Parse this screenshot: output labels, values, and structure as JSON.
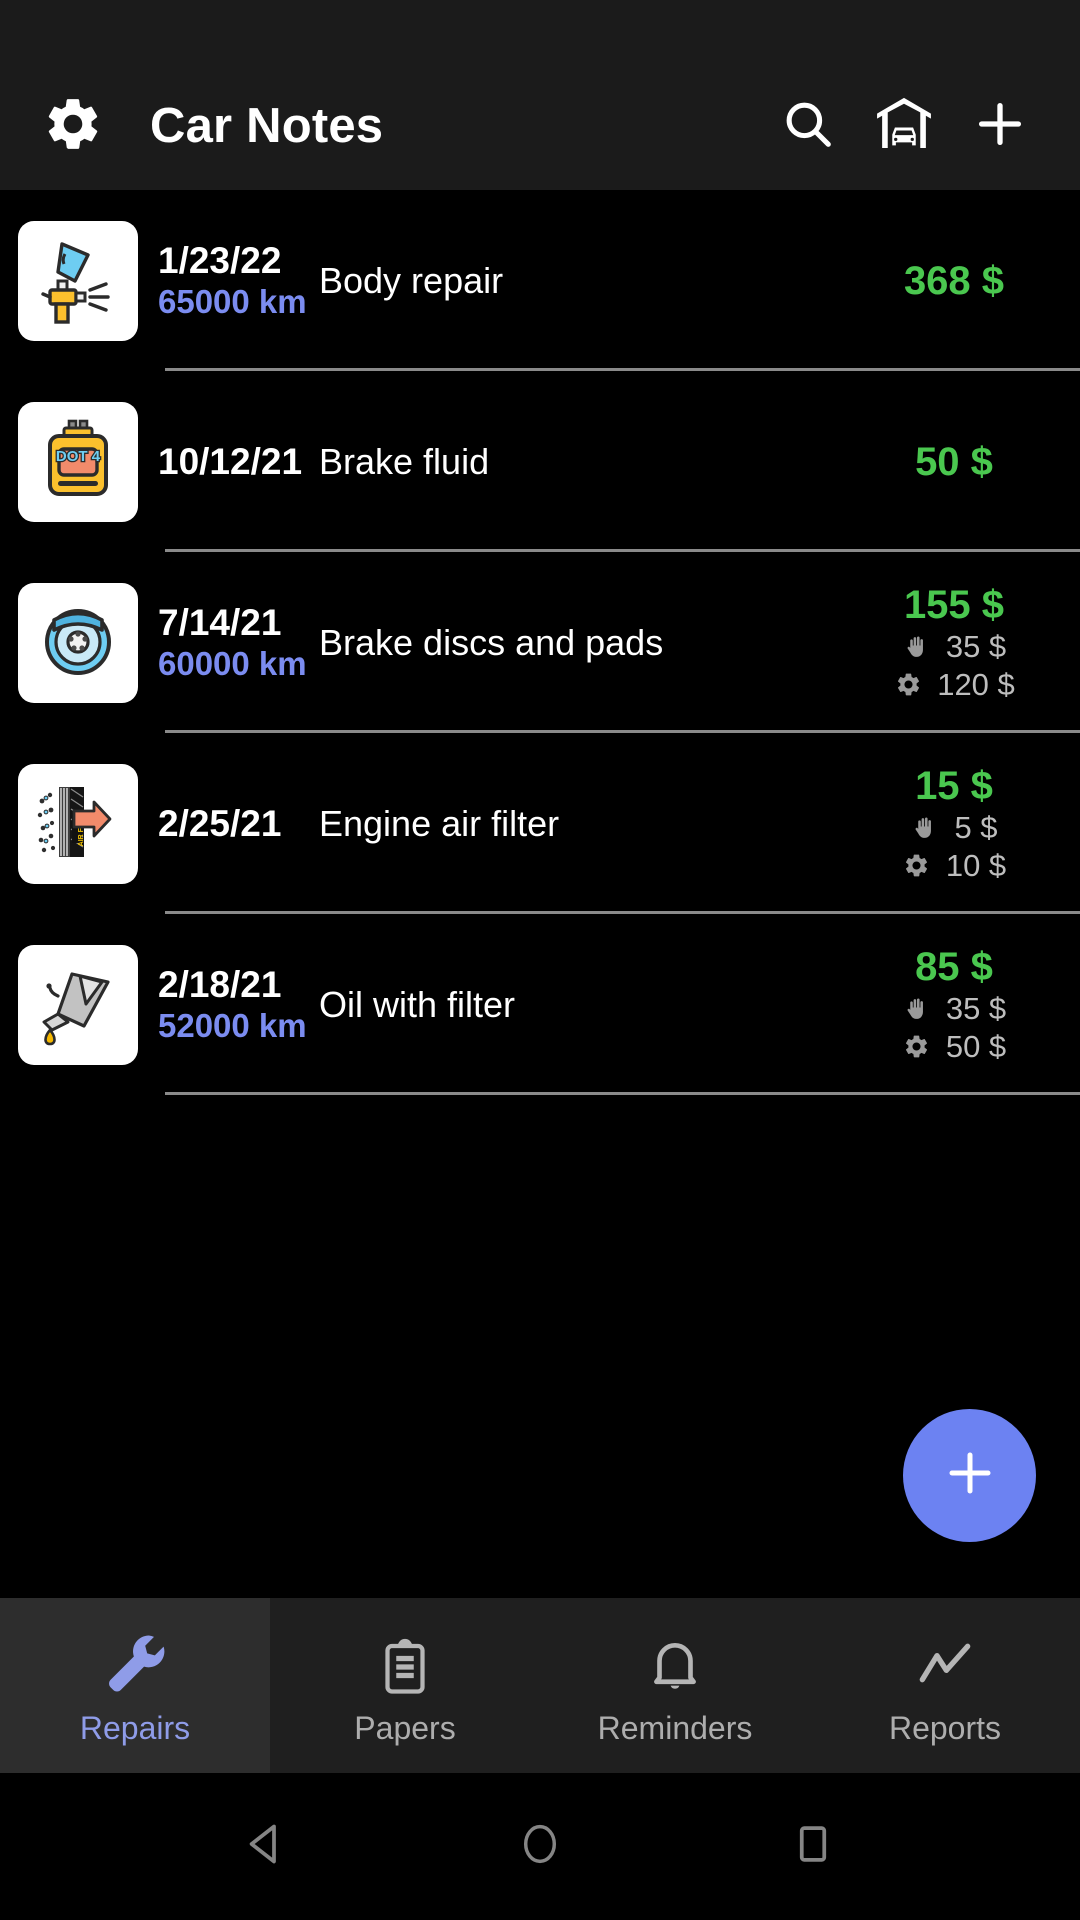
{
  "app": {
    "title": "Car Notes",
    "accent_periwinkle": "#6c82f2",
    "accent_green": "#4ac74f",
    "odometer_color": "#7b8cf0",
    "appbar_bg": "#1b1b1b",
    "screen_bg": "#000000"
  },
  "appbar": {
    "settings_icon": "gear-icon",
    "search_icon": "search-icon",
    "garage_icon": "garage-car-icon",
    "add_icon": "plus-icon"
  },
  "repairs": [
    {
      "date": "1/23/22",
      "odometer": "65000 km",
      "title": "Body repair",
      "total": "368 $",
      "labor": null,
      "parts": null,
      "icon": "spray-gun-icon"
    },
    {
      "date": "10/12/21",
      "odometer": "",
      "title": "Brake fluid",
      "total": "50 $",
      "labor": null,
      "parts": null,
      "icon": "brake-fluid-dot4-icon"
    },
    {
      "date": "7/14/21",
      "odometer": "60000 km",
      "title": "Brake discs and pads",
      "total": "155 $",
      "labor": "35 $",
      "parts": "120 $",
      "icon": "brake-disc-icon"
    },
    {
      "date": "2/25/21",
      "odometer": "",
      "title": "Engine air filter",
      "total": "15 $",
      "labor": "5 $",
      "parts": "10 $",
      "icon": "air-filter-icon"
    },
    {
      "date": "2/18/21",
      "odometer": "52000 km",
      "title": "Oil with filter",
      "total": "85 $",
      "labor": "35 $",
      "parts": "50 $",
      "icon": "oil-can-icon"
    }
  ],
  "cost_icons": {
    "labor": "hand-icon",
    "parts": "gear-icon"
  },
  "fab": {
    "label": "+",
    "icon": "plus-icon"
  },
  "tabs": [
    {
      "label": "Repairs",
      "icon": "wrench-icon",
      "active": true
    },
    {
      "label": "Papers",
      "icon": "clipboard-icon",
      "active": false
    },
    {
      "label": "Reminders",
      "icon": "bell-icon",
      "active": false
    },
    {
      "label": "Reports",
      "icon": "chart-line-icon",
      "active": false
    }
  ],
  "android_nav": {
    "back": "back-triangle-icon",
    "home": "home-circle-icon",
    "recents": "recents-square-icon"
  }
}
